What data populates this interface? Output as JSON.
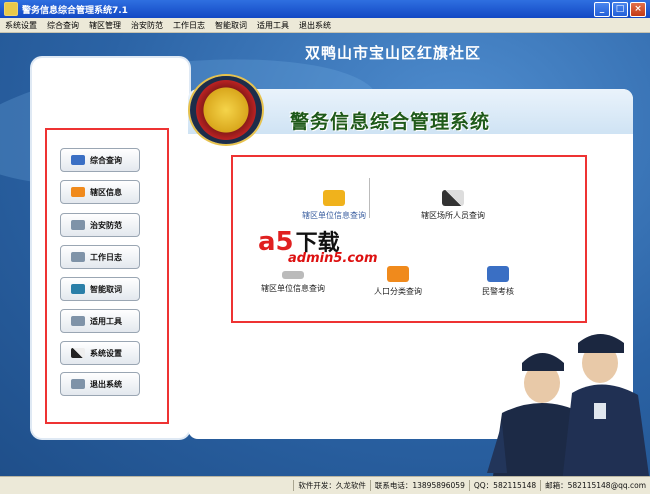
{
  "window": {
    "title": "警务信息综合管理系统7.1",
    "min": "_",
    "max": "□",
    "close": "×"
  },
  "menu": [
    "系统设置",
    "综合查询",
    "辖区管理",
    "治安防范",
    "工作日志",
    "智能取词",
    "适用工具",
    "退出系统"
  ],
  "community": "双鸭山市宝山区红旗社区",
  "system_title": "警务信息综合管理系统",
  "sidebar": [
    {
      "label": "综合查询",
      "color": "#3a6fc4"
    },
    {
      "label": "辖区信息",
      "color": "#f08a1c"
    },
    {
      "label": "治安防范",
      "color": "#7f93a8"
    },
    {
      "label": "工作日志",
      "color": "#7f93a8"
    },
    {
      "label": "智能取词",
      "color": "#2a7fa8"
    },
    {
      "label": "适用工具",
      "color": "#7f93a8"
    },
    {
      "label": "系统设置",
      "color": "#222222"
    },
    {
      "label": "退出系统",
      "color": "#7f93a8"
    }
  ],
  "items": [
    {
      "label": "辖区单位信息查询",
      "color": "#f0b21c"
    },
    {
      "label": "辖区场所人员查询",
      "color": "#333333"
    },
    {
      "label": "辖区单位信息查询",
      "color": "#bbbbbb"
    },
    {
      "label": "人口分类查询",
      "color": "#f08a1c"
    },
    {
      "label": "民警考核",
      "color": "#3a6fc4"
    }
  ],
  "watermark": {
    "a5": "a5",
    "dl": "下载",
    "site": "admin5.com"
  },
  "status": {
    "dev": "软件开发：久龙软件",
    "phone": "联系电话：13895896059",
    "qq": "QQ：582115148",
    "mail": "邮箱：582115148@qq.com"
  }
}
